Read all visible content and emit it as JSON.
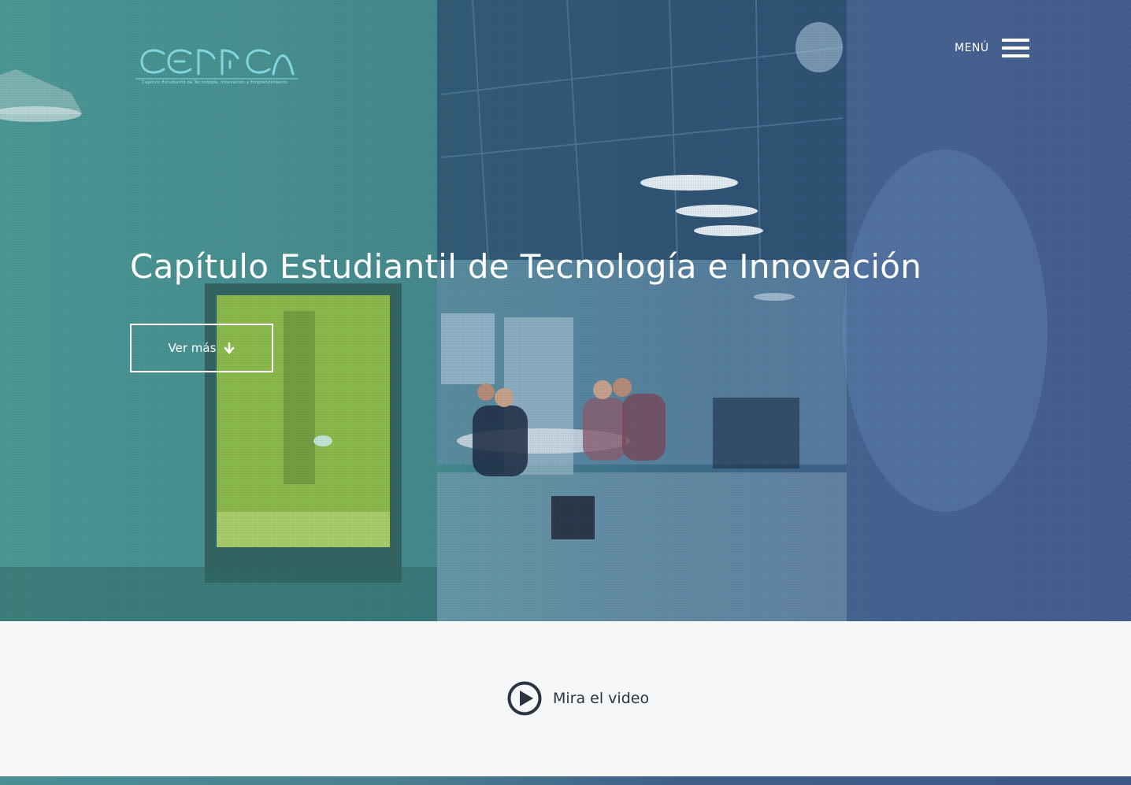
{
  "header": {
    "logo_text": "CETICA",
    "logo_tagline": "Capítulo Estudiantil de Tecnología, Innovación y Emprendimiento",
    "menu_label": "MENÚ",
    "menu_icon": "hamburger-icon"
  },
  "hero": {
    "title": "Capítulo Estudiantil de Tecnología e Innovación",
    "cta_label": "Ver más",
    "cta_icon": "arrow-down-icon"
  },
  "video": {
    "label": "Mira el video",
    "icon": "play-circle-icon"
  },
  "colors": {
    "logo": "#7fd6df",
    "text_dark": "#2b3442",
    "section_bg": "#f5f7f9",
    "overlay_teal": "#4d9b98",
    "overlay_blue": "#41578a"
  }
}
